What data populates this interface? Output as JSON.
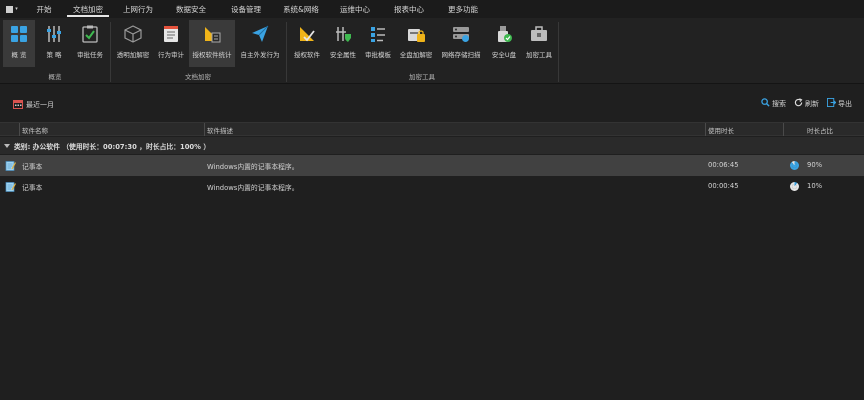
{
  "menubar": {
    "tabs": [
      {
        "label": "开始",
        "active": false
      },
      {
        "label": "文档加密",
        "active": true
      },
      {
        "label": "上网行为",
        "active": false
      },
      {
        "label": "数据安全",
        "active": false
      },
      {
        "label": "设备管理",
        "active": false
      },
      {
        "label": "系统&网络",
        "active": false
      },
      {
        "label": "运维中心",
        "active": false
      },
      {
        "label": "报表中心",
        "active": false
      },
      {
        "label": "更多功能",
        "active": false
      }
    ]
  },
  "ribbon": {
    "groups": [
      {
        "label": "概览"
      },
      {
        "label": "文档加密"
      },
      {
        "label": "加密工具"
      }
    ],
    "buttons": [
      {
        "label": "概 览",
        "icon": "overview-grid-icon"
      },
      {
        "label": "策 略",
        "icon": "policy-sliders-icon"
      },
      {
        "label": "审批任务",
        "icon": "approval-task-icon"
      },
      {
        "label": "透明加解密",
        "icon": "transparent-crypto-cube-icon"
      },
      {
        "label": "行为审计",
        "icon": "behavior-audit-icon"
      },
      {
        "label": "授权软件统计",
        "icon": "authorized-software-stats-icon"
      },
      {
        "label": "自主外发行为",
        "icon": "send-paper-plane-icon"
      },
      {
        "label": "授权软件",
        "icon": "authorized-software-icon"
      },
      {
        "label": "安全属性",
        "icon": "security-attribute-icon"
      },
      {
        "label": "审批模板",
        "icon": "approval-template-icon"
      },
      {
        "label": "全盘加解密",
        "icon": "full-disk-crypto-icon"
      },
      {
        "label": "网络存储扫描",
        "icon": "network-storage-scan-icon"
      },
      {
        "label": "安全U盘",
        "icon": "secure-usb-icon"
      },
      {
        "label": "加密工具",
        "icon": "encryption-toolbox-icon"
      }
    ]
  },
  "toolbar": {
    "period_label": "最近一月",
    "search_label": "搜索",
    "refresh_label": "刷新",
    "export_label": "导出"
  },
  "table": {
    "columns": [
      "软件名称",
      "软件描述",
      "使用时长",
      "时长占比"
    ],
    "group_label": "类别: 办公软件 （使用时长：00:07:30 ，时长占比：100% ）",
    "rows": [
      {
        "name": "记事本",
        "description": "Windows内置的记事本程序。",
        "duration": "00:06:45",
        "ratio": "90%",
        "ratio_value": 90,
        "selected": true
      },
      {
        "name": "记事本",
        "description": "Windows内置的记事本程序。",
        "duration": "00:00:45",
        "ratio": "10%",
        "ratio_value": 10,
        "selected": false
      }
    ]
  },
  "colors": {
    "accent_blue": "#3aa3e3",
    "icon_yellow": "#f0b419",
    "icon_green": "#3fb950",
    "selected_row": "#414141"
  }
}
